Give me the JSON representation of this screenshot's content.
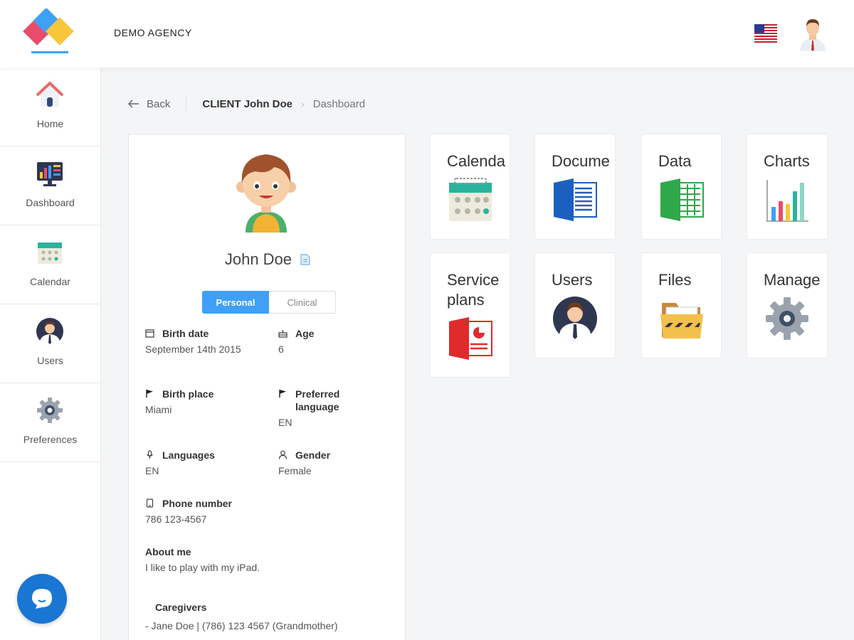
{
  "header": {
    "agency": "DEMO AGENCY"
  },
  "sidebar": {
    "items": [
      {
        "label": "Home",
        "icon": "home-icon"
      },
      {
        "label": "Dashboard",
        "icon": "dashboard-icon"
      },
      {
        "label": "Calendar",
        "icon": "calendar-icon"
      },
      {
        "label": "Users",
        "icon": "user-icon"
      },
      {
        "label": "Preferences",
        "icon": "gear-icon"
      }
    ]
  },
  "breadcrumb": {
    "back": "Back",
    "client": "CLIENT John Doe",
    "current": "Dashboard"
  },
  "profile": {
    "name": "John Doe",
    "tabs": [
      "Personal",
      "Clinical"
    ],
    "fields": {
      "birth_date": {
        "label": "Birth date",
        "value": "September 14th 2015"
      },
      "age": {
        "label": "Age",
        "value": "6"
      },
      "birth_place": {
        "label": "Birth place",
        "value": "Miami"
      },
      "preferred_language": {
        "label": "Preferred language",
        "value": "EN"
      },
      "languages": {
        "label": "Languages",
        "value": "EN"
      },
      "gender": {
        "label": "Gender",
        "value": "Female"
      },
      "phone": {
        "label": "Phone number",
        "value": "786 123-4567"
      },
      "about": {
        "label": "About me",
        "value": "I like to play with my iPad."
      },
      "caregivers": {
        "label": "Caregivers",
        "value": "- Jane Doe | (786) 123 4567 (Grandmother)"
      }
    }
  },
  "tiles": [
    {
      "label": "Calenda",
      "icon": "calendar-icon"
    },
    {
      "label": "Docume",
      "icon": "document-icon"
    },
    {
      "label": "Data",
      "icon": "spreadsheet-icon"
    },
    {
      "label": "Charts",
      "icon": "bar-chart-icon"
    },
    {
      "label": "Service plans",
      "icon": "presentation-icon"
    },
    {
      "label": "Users",
      "icon": "user-icon"
    },
    {
      "label": "Files",
      "icon": "folder-icon"
    },
    {
      "label": "Manage",
      "icon": "gear-icon"
    }
  ],
  "colors": {
    "accent": "#3ea0f7",
    "chat": "#1976d2"
  }
}
